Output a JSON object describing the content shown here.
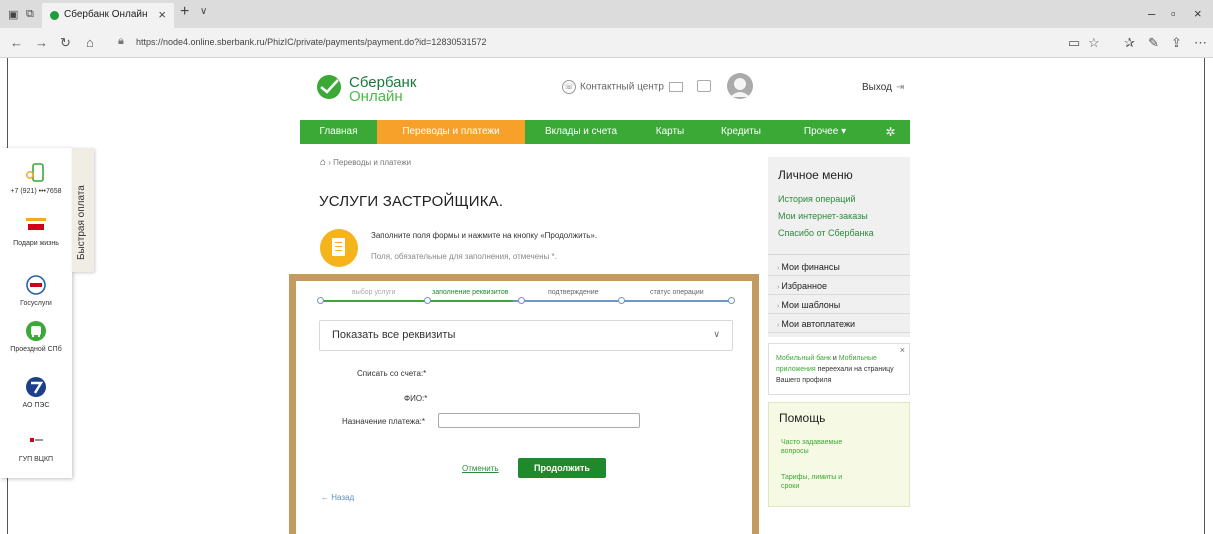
{
  "browser": {
    "tab_title": "Сбербанк Онлайн",
    "url": "https://node4.online.sberbank.ru/PhizIC/private/payments/payment.do?id=12830531572"
  },
  "quick_pay": {
    "tab_label": "Быстрая оплата",
    "items": [
      {
        "label": "+7 (921) •••7658",
        "icon": "phone-icon"
      },
      {
        "label": "Подари жизнь",
        "icon": "podari-zhizn-logo"
      },
      {
        "label": "Госуслуги",
        "icon": "gosuslugi-logo"
      },
      {
        "label": "Проездной СПб",
        "icon": "bus-icon"
      },
      {
        "label": "АО ПЭС",
        "icon": "pes-logo"
      },
      {
        "label": "ГУП ВЦКП",
        "icon": "vckp-logo"
      }
    ]
  },
  "header": {
    "logo_line1": "Сбербанк",
    "logo_line2": "Онлайн",
    "contact_center": "Контактный центр",
    "exit": "Выход"
  },
  "menu": {
    "items": [
      "Главная",
      "Переводы и платежи",
      "Вклады и счета",
      "Карты",
      "Кредиты",
      "Прочее ▾"
    ],
    "active_index": 1,
    "settings_icon": "gear-icon"
  },
  "breadcrumb": "Переводы и платежи",
  "page_title": "УСЛУГИ ЗАСТРОЙЩИКА.",
  "hint": {
    "line1": "Заполните поля формы и нажмите на кнопку «Продолжить».",
    "line2": "Поля, обязательные для заполнения, отмечены *."
  },
  "steps": {
    "labels": [
      "выбор услуги",
      "заполнение реквизитов",
      "подтверждение",
      "статус операции"
    ],
    "current_index": 1,
    "colors": {
      "done": "#3aa935",
      "todo": "#6e96c7",
      "muted": "#aaaaaa",
      "current": "#1f8a2b"
    }
  },
  "details_toggle": "Показать все реквизиты",
  "form": {
    "account_label": "Списать со счета:*",
    "fio_label": "ФИО:*",
    "purpose_label": "Назначение платежа:*",
    "purpose_value": ""
  },
  "actions": {
    "cancel": "Отменить",
    "continue": "Продолжить",
    "back": "← Назад"
  },
  "personal_menu": {
    "title": "Личное меню",
    "links": [
      "История операций",
      "Мои интернет-заказы",
      "Спасибо от Сбербанка"
    ],
    "sections": [
      "Мои финансы",
      "Избранное",
      "Мои шаблоны",
      "Мои автоплатежи"
    ]
  },
  "notice": {
    "part1": "Мобильный банк",
    "part2": " и ",
    "part3": "Мобильные приложения",
    "part4": " переехали на страницу Вашего профиля"
  },
  "help": {
    "title": "Помощь",
    "links": [
      "Часто задаваемые вопросы",
      "Тарифы, лимиты и сроки"
    ]
  },
  "colors": {
    "brand_green": "#3aa935",
    "active_orange": "#f7a12a",
    "frame_gold": "#c39b5e"
  }
}
